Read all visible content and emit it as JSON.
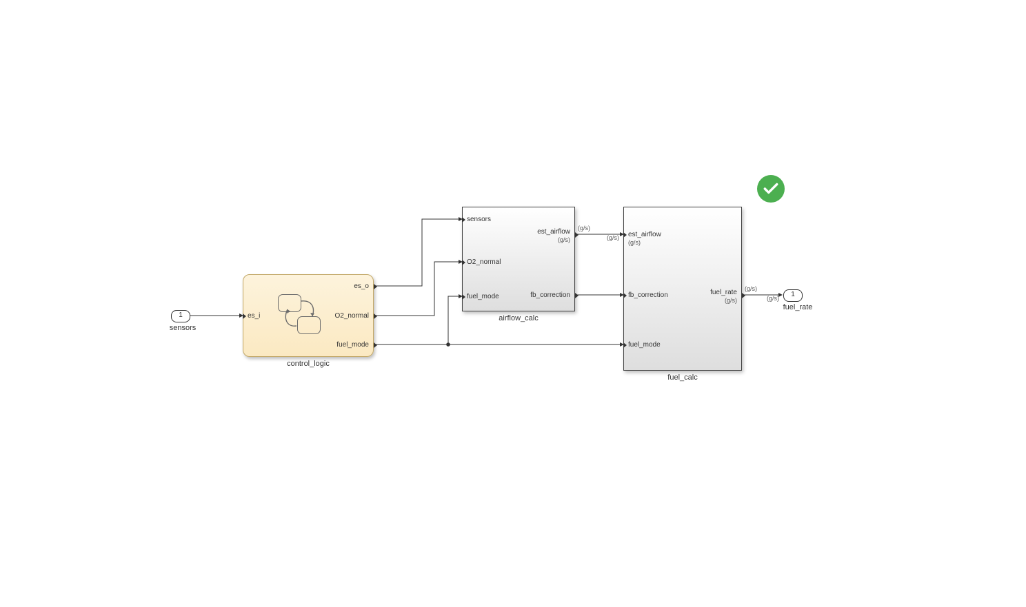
{
  "inport": {
    "number": "1",
    "name": "sensors"
  },
  "outport": {
    "number": "1",
    "name": "fuel_rate"
  },
  "blocks": {
    "control_logic": {
      "name": "control_logic",
      "in": {
        "es_i": "es_i"
      },
      "out": {
        "es_o": "es_o",
        "o2_normal": "O2_normal",
        "fuel_mode": "fuel_mode"
      }
    },
    "airflow_calc": {
      "name": "airflow_calc",
      "in": {
        "sensors": "sensors",
        "o2_normal": "O2_normal",
        "fuel_mode": "fuel_mode"
      },
      "out": {
        "est_airflow": {
          "label": "est_airflow",
          "unit": "(g/s)"
        },
        "fb_correction": {
          "label": "fb_correction"
        }
      }
    },
    "fuel_calc": {
      "name": "fuel_calc",
      "in": {
        "est_airflow": {
          "label": "est_airflow",
          "unit": "(g/s)"
        },
        "fb_correction": {
          "label": "fb_correction"
        },
        "fuel_mode": {
          "label": "fuel_mode"
        }
      },
      "out": {
        "fuel_rate": {
          "label": "fuel_rate",
          "unit": "(g/s)"
        }
      }
    }
  },
  "signal_units": {
    "est_airflow_out": "(g/s)",
    "est_airflow_in": "(g/s)",
    "fuel_rate_out": "(g/s)",
    "fuel_rate_wire": "(g/s)"
  }
}
